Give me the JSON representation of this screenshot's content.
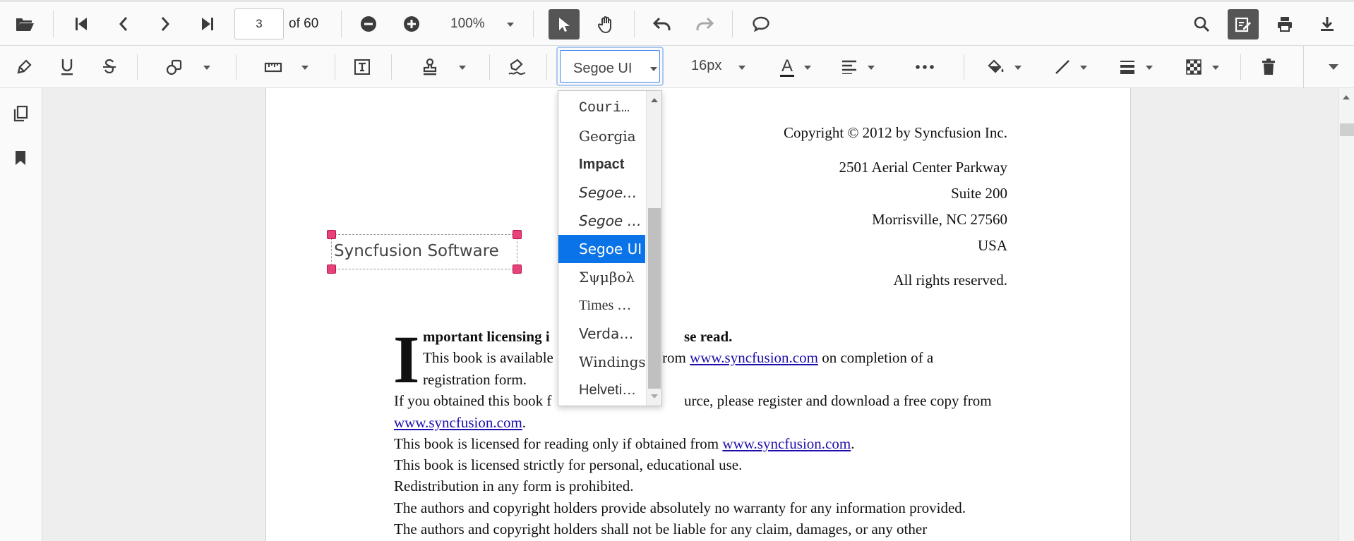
{
  "navigation": {
    "current_page": "3",
    "page_count_label": "of 60",
    "zoom_level": "100%"
  },
  "text_properties": {
    "font_family": "Segoe UI",
    "font_size": "16px",
    "font_color_icon": "A"
  },
  "font_dropdown": {
    "options": [
      {
        "label": "Couri…",
        "family": "\"Liberation Mono\", monospace",
        "weight": "normal",
        "style": "normal"
      },
      {
        "label": "Georgia",
        "family": "\"DejaVu Serif\", serif",
        "weight": "normal",
        "style": "normal"
      },
      {
        "label": "Impact",
        "family": "\"Liberation Sans\", sans-serif",
        "weight": "bold",
        "style": "normal"
      },
      {
        "label": "Segoe…",
        "family": "\"DejaVu Sans\", sans-serif",
        "weight": "normal",
        "style": "italic"
      },
      {
        "label": "Segoe …",
        "family": "\"DejaVu Sans\", sans-serif",
        "weight": "normal",
        "style": "italic"
      },
      {
        "label": "Segoe UI",
        "family": "\"DejaVu Sans\", sans-serif",
        "weight": "normal",
        "style": "normal",
        "selected": true
      },
      {
        "label": "Σψμβολ",
        "family": "\"DejaVu Serif\", serif",
        "weight": "normal",
        "style": "normal"
      },
      {
        "label": "Times …",
        "family": "\"Liberation Serif\", serif",
        "weight": "normal",
        "style": "normal"
      },
      {
        "label": "Verda…",
        "family": "\"DejaVu Sans\", sans-serif",
        "weight": "normal",
        "style": "normal"
      },
      {
        "label": "Windings",
        "family": "\"DejaVu Serif\", serif",
        "weight": "normal",
        "style": "normal"
      },
      {
        "label": "Helveti…",
        "family": "\"Liberation Sans\", sans-serif",
        "weight": "normal",
        "style": "normal"
      }
    ]
  },
  "annotation": {
    "text": "Syncfusion Software"
  },
  "document": {
    "copyright": "Copyright © 2012 by Syncfusion Inc.",
    "address1": "2501 Aerial Center Parkway",
    "address2": "Suite 200",
    "address3": "Morrisville, NC 27560",
    "country": "USA",
    "rights": "All rights reserved.",
    "dropcap": "I",
    "heading_a": "mportant licensing i",
    "heading_b": "se read.",
    "line1_a": "This book is available",
    "line1_b": "ad from",
    "link": "www.syncfusion.com",
    "line1_c": "on completion of a",
    "line2": "registration form.",
    "line3_a": "If you obtained this book f",
    "line3_b": "urce, please register and download a free copy from",
    "line4_end": ".",
    "line5_a": "This book is licensed for reading only if obtained from",
    "line5_end": ".",
    "line6": "This book is licensed strictly for personal, educational use.",
    "line7": "Redistribution in any form is prohibited.",
    "line8": "The authors and copyright holders provide absolutely no warranty for any information provided.",
    "line9": "The authors and copyright holders shall not be liable for any claim, damages, or any other"
  },
  "colors": {
    "accent": "#0a73e8",
    "active_tool": "#555555",
    "handle": "#e84378",
    "link": "#1a0dab"
  }
}
